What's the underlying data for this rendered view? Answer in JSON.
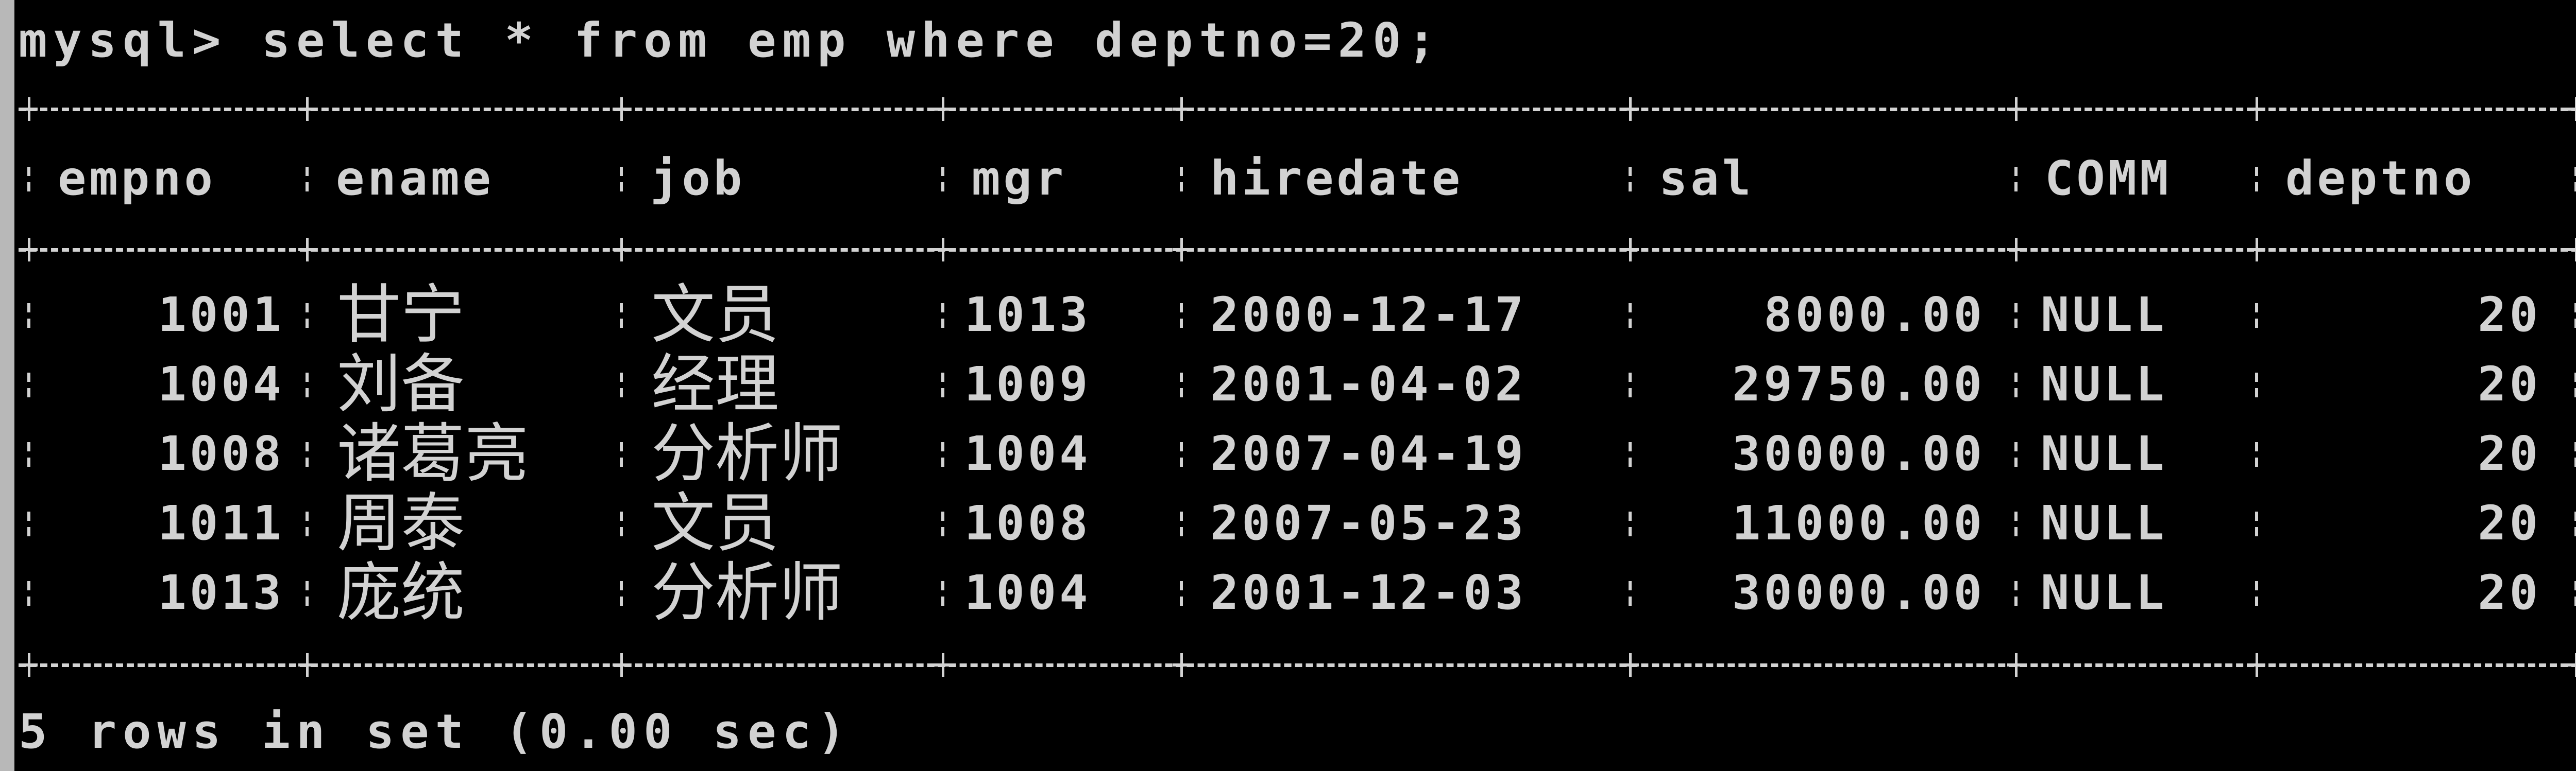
{
  "window": {
    "background": "#000000",
    "text_color": "#d2d2d2"
  },
  "prompt": "mysql> select * from emp where deptno=20;",
  "columns": [
    "empno",
    "ename",
    "job",
    "mgr",
    "hiredate",
    "sal",
    "COMM",
    "deptno"
  ],
  "rows": [
    [
      "1001",
      "甘宁",
      "文员",
      "1013",
      "2000-12-17",
      "8000.00",
      "NULL",
      "20"
    ],
    [
      "1004",
      "刘备",
      "经理",
      "1009",
      "2001-04-02",
      "29750.00",
      "NULL",
      "20"
    ],
    [
      "1008",
      "诸葛亮",
      "分析师",
      "1004",
      "2007-04-19",
      "30000.00",
      "NULL",
      "20"
    ],
    [
      "1011",
      "周泰",
      "文员",
      "1008",
      "2007-05-23",
      "11000.00",
      "NULL",
      "20"
    ],
    [
      "1013",
      "庞统",
      "分析师",
      "1004",
      "2001-12-03",
      "30000.00",
      "NULL",
      "20"
    ]
  ],
  "footer": "5 rows in set (0.00 sec)"
}
